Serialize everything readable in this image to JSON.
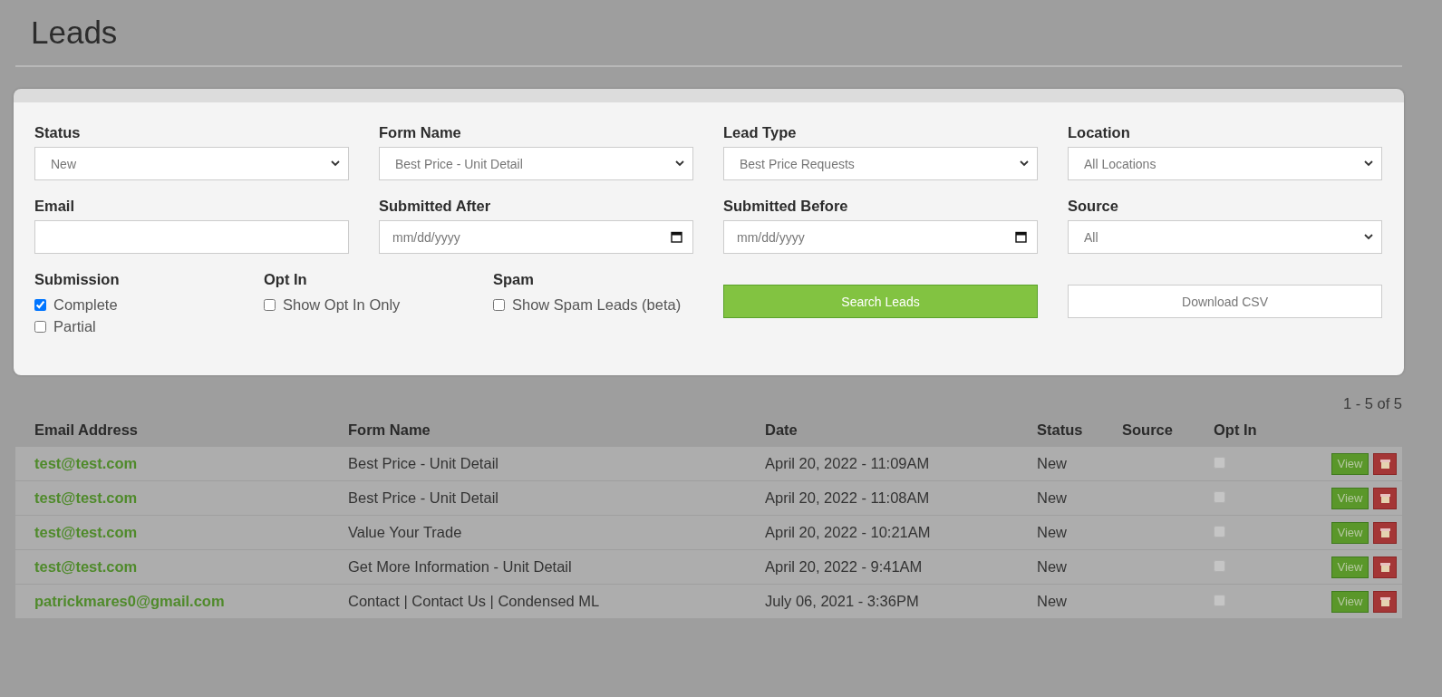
{
  "page": {
    "title": "Leads"
  },
  "filters": {
    "fields": [
      {
        "kind": "select",
        "label": "Status",
        "value": "New"
      },
      {
        "kind": "select",
        "label": "Form Name",
        "value": "Best Price - Unit Detail"
      },
      {
        "kind": "select",
        "label": "Lead Type",
        "value": "Best Price Requests"
      },
      {
        "kind": "select",
        "label": "Location",
        "value": "All Locations"
      },
      {
        "kind": "text",
        "label": "Email"
      },
      {
        "kind": "date",
        "label": "Submitted After",
        "placeholder": "mm/dd/yyyy"
      },
      {
        "kind": "date",
        "label": "Submitted Before",
        "placeholder": "mm/dd/yyyy"
      },
      {
        "kind": "select",
        "label": "Source",
        "value": "All"
      }
    ],
    "option_groups": [
      {
        "label": "Submission",
        "options": [
          {
            "label": "Complete",
            "checked": true
          },
          {
            "label": "Partial",
            "checked": false
          }
        ]
      },
      {
        "label": "Opt In",
        "options": [
          {
            "label": "Show Opt In Only",
            "checked": false
          }
        ]
      },
      {
        "label": "Spam",
        "options": [
          {
            "label": "Show Spam Leads (beta)",
            "checked": false
          }
        ]
      }
    ],
    "buttons": [
      {
        "kind": "primary",
        "label": "Search Leads"
      },
      {
        "kind": "secondary",
        "label": "Download CSV"
      }
    ]
  },
  "results": {
    "pagination": "1 - 5 of 5",
    "columns": [
      "Email Address",
      "Form Name",
      "Date",
      "Status",
      "Source",
      "Opt In"
    ],
    "rows": [
      {
        "email": "test@test.com",
        "form_name": "Best Price - Unit Detail",
        "date": "April 20, 2022 - 11:09AM",
        "status": "New",
        "opt_in": false,
        "action": "View"
      },
      {
        "email": "test@test.com",
        "form_name": "Best Price - Unit Detail",
        "date": "April 20, 2022 - 11:08AM",
        "status": "New",
        "opt_in": false,
        "action": "View"
      },
      {
        "email": "test@test.com",
        "form_name": "Value Your Trade",
        "date": "April 20, 2022 - 10:21AM",
        "status": "New",
        "opt_in": false,
        "action": "View"
      },
      {
        "email": "test@test.com",
        "form_name": "Get More Information - Unit Detail",
        "date": "April 20, 2022 - 9:41AM",
        "status": "New",
        "opt_in": false,
        "action": "View"
      },
      {
        "email": "patrickmares0@gmail.com",
        "form_name": "Contact | Contact Us | Condensed ML",
        "date": "July 06, 2021 - 3:36PM",
        "status": "New",
        "opt_in": false,
        "action": "View"
      }
    ]
  }
}
